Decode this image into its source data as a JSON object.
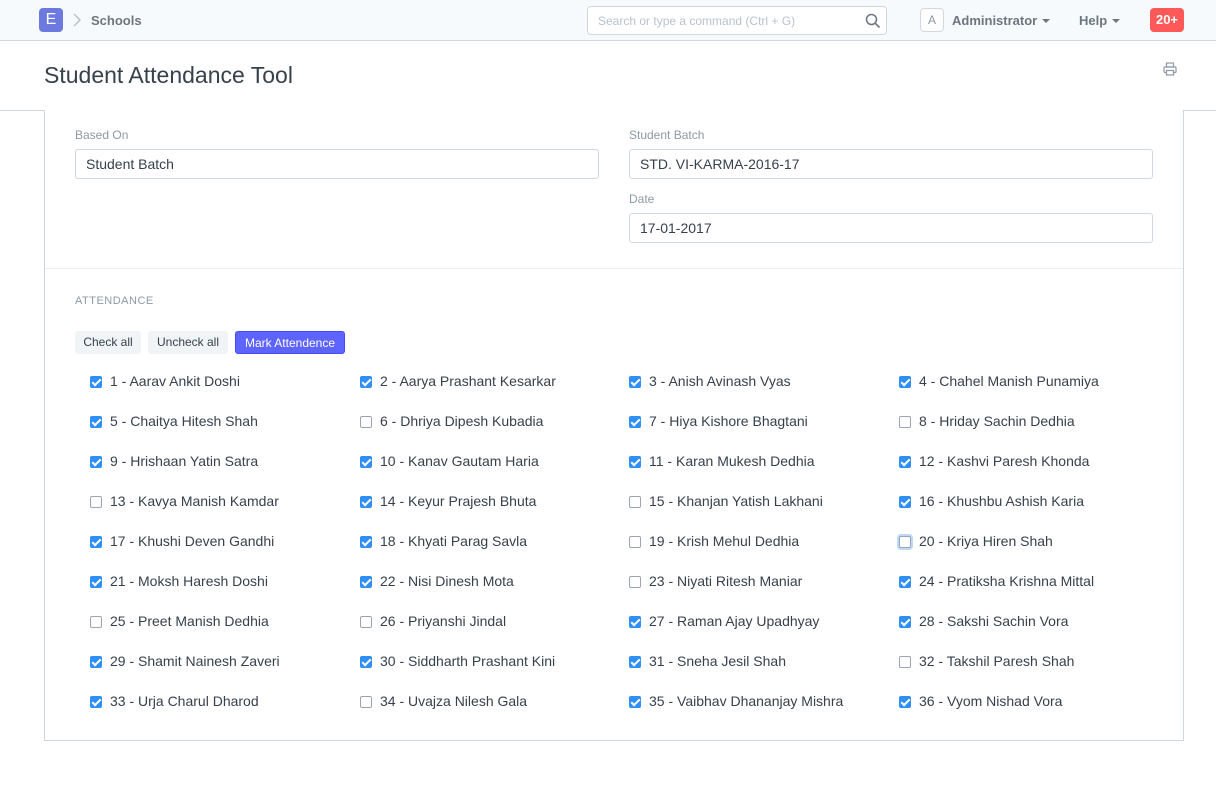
{
  "navbar": {
    "logo_letter": "E",
    "breadcrumb": "Schools",
    "search_placeholder": "Search or type a command (Ctrl + G)",
    "avatar_letter": "A",
    "user": "Administrator",
    "help": "Help",
    "notifications": "20+"
  },
  "page": {
    "title": "Student Attendance Tool"
  },
  "form": {
    "based_on_label": "Based On",
    "based_on_value": "Student Batch",
    "student_batch_label": "Student Batch",
    "student_batch_value": "STD. VI-KARMA-2016-17",
    "date_label": "Date",
    "date_value": "17-01-2017"
  },
  "attendance": {
    "section_title": "ATTENDANCE",
    "check_all": "Check all",
    "uncheck_all": "Uncheck all",
    "mark_attendance": "Mark Attendence",
    "students": [
      {
        "label": "1 - Aarav Ankit Doshi",
        "checked": true
      },
      {
        "label": "2 - Aarya Prashant Kesarkar",
        "checked": true
      },
      {
        "label": "3 - Anish Avinash Vyas",
        "checked": true
      },
      {
        "label": "4 - Chahel Manish Punamiya",
        "checked": true
      },
      {
        "label": "5 - Chaitya Hitesh Shah",
        "checked": true
      },
      {
        "label": "6 - Dhriya Dipesh Kubadia",
        "checked": false
      },
      {
        "label": "7 - Hiya Kishore Bhagtani",
        "checked": true
      },
      {
        "label": "8 - Hriday Sachin Dedhia",
        "checked": false
      },
      {
        "label": "9 - Hrishaan Yatin Satra",
        "checked": true
      },
      {
        "label": "10 - Kanav Gautam Haria",
        "checked": true
      },
      {
        "label": "11 - Karan Mukesh Dedhia",
        "checked": true
      },
      {
        "label": "12 - Kashvi Paresh Khonda",
        "checked": true
      },
      {
        "label": "13 - Kavya Manish Kamdar",
        "checked": false
      },
      {
        "label": "14 - Keyur Prajesh Bhuta",
        "checked": true
      },
      {
        "label": "15 - Khanjan Yatish Lakhani",
        "checked": false
      },
      {
        "label": "16 - Khushbu Ashish Karia",
        "checked": true
      },
      {
        "label": "17 - Khushi Deven Gandhi",
        "checked": true
      },
      {
        "label": "18 - Khyati Parag Savla",
        "checked": true
      },
      {
        "label": "19 - Krish Mehul Dedhia",
        "checked": false
      },
      {
        "label": "20 - Kriya Hiren Shah",
        "checked": false,
        "focused": true
      },
      {
        "label": "21 - Moksh Haresh Doshi",
        "checked": true
      },
      {
        "label": "22 - Nisi Dinesh Mota",
        "checked": true
      },
      {
        "label": "23 - Niyati Ritesh Maniar",
        "checked": false
      },
      {
        "label": "24 - Pratiksha Krishna Mittal",
        "checked": true
      },
      {
        "label": "25 - Preet Manish Dedhia",
        "checked": false
      },
      {
        "label": "26 - Priyanshi Jindal",
        "checked": false
      },
      {
        "label": "27 - Raman Ajay Upadhyay",
        "checked": true
      },
      {
        "label": "28 - Sakshi Sachin Vora",
        "checked": true
      },
      {
        "label": "29 - Shamit Nainesh Zaveri",
        "checked": true
      },
      {
        "label": "30 - Siddharth Prashant Kini",
        "checked": true
      },
      {
        "label": "31 - Sneha Jesil Shah",
        "checked": true
      },
      {
        "label": "32 - Takshil Paresh Shah",
        "checked": false
      },
      {
        "label": "33 - Urja Charul Dharod",
        "checked": true
      },
      {
        "label": "34 - Uvajza Nilesh Gala",
        "checked": false
      },
      {
        "label": "35 - Vaibhav Dhananjay Mishra",
        "checked": true
      },
      {
        "label": "36 - Vyom Nishad Vora",
        "checked": true
      }
    ]
  },
  "colors": {
    "primary": "#5e64ff",
    "checkbox": "#2f8ff5",
    "badge": "#ff5858",
    "logo": "#6c7ae0"
  }
}
